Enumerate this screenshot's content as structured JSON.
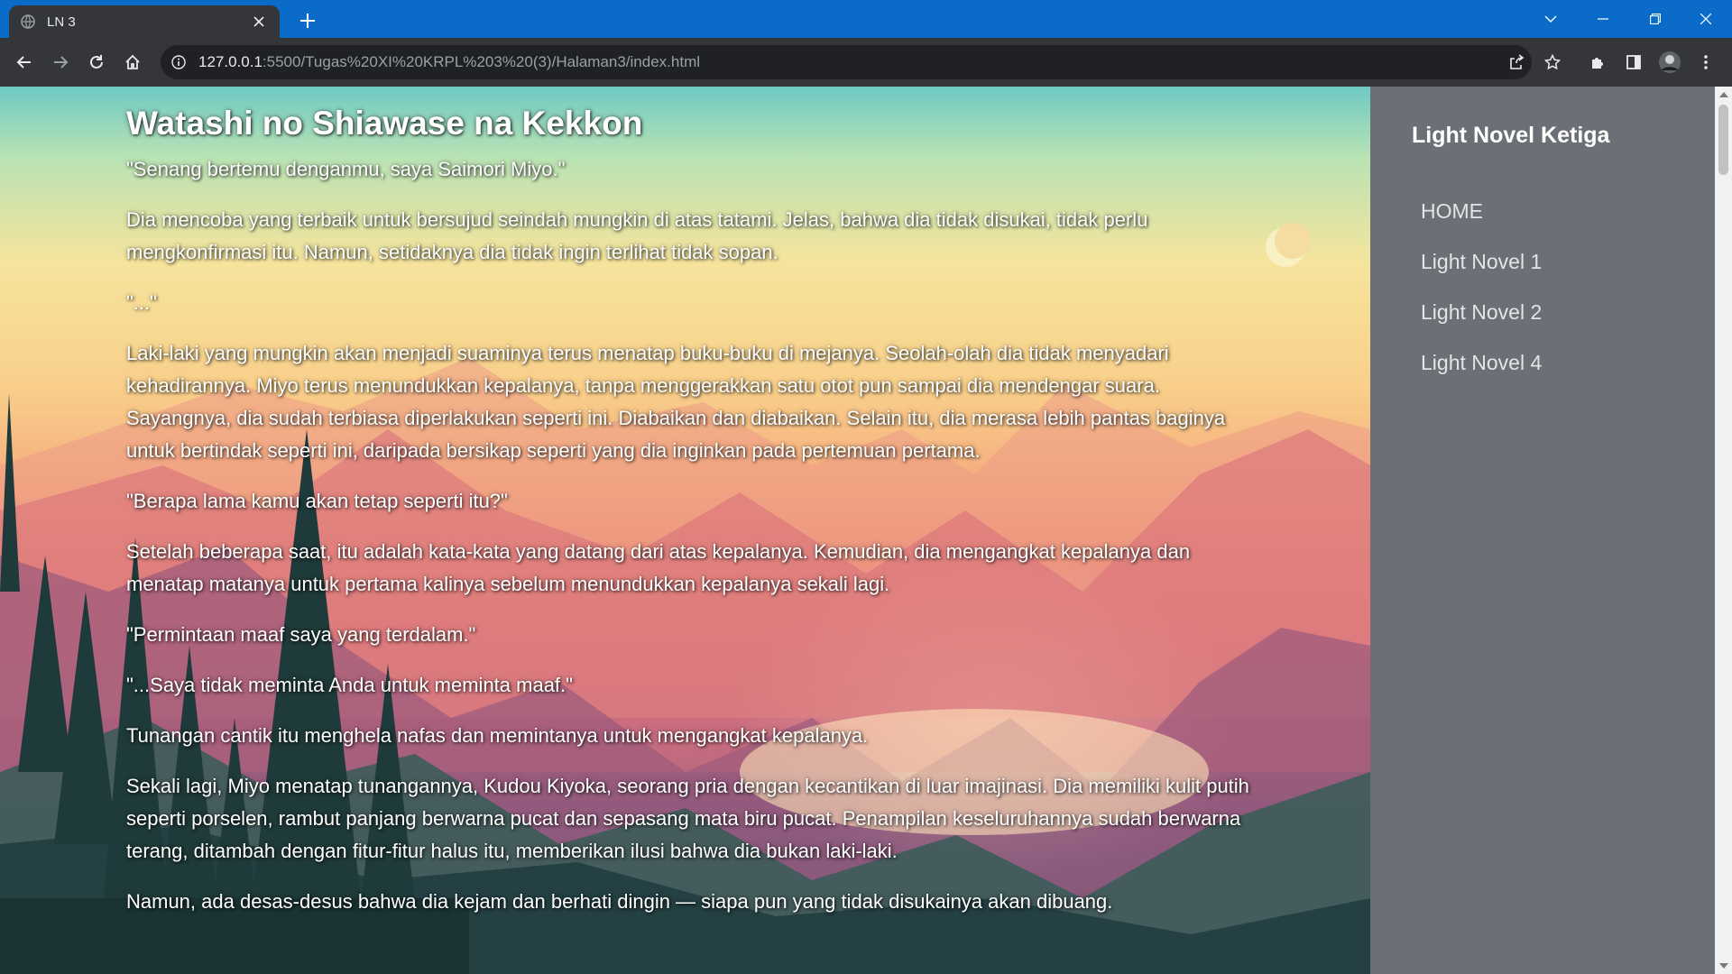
{
  "browser": {
    "tab": {
      "title": "LN 3",
      "favicon": "globe-icon",
      "close_icon": "close-icon"
    },
    "new_tab_icon": "plus-icon",
    "window_controls": [
      "chevron-down-icon",
      "minimize-icon",
      "restore-icon",
      "close-icon"
    ],
    "nav": [
      "back-icon",
      "forward-icon",
      "reload-icon",
      "home-icon"
    ],
    "address": {
      "info_icon": "info-icon",
      "host": "127.0.0.1",
      "path": ":5500/Tugas%20XI%20KRPL%203%20(3)/Halaman3/index.html"
    },
    "right_icons": [
      "share-icon",
      "star-icon",
      "extensions-icon",
      "side-panel-icon",
      "profile-avatar",
      "menu-icon"
    ]
  },
  "article": {
    "title": "Watashi no Shiawase na Kekkon",
    "paragraphs": [
      "\"Senang bertemu denganmu, saya Saimori Miyo.\"",
      "Dia mencoba yang terbaik untuk bersujud seindah mungkin di atas tatami. Jelas, bahwa dia tidak disukai, tidak perlu mengkonfirmasi itu. Namun, setidaknya dia tidak ingin terlihat tidak sopan.",
      "\"...\"",
      "Laki-laki yang mungkin akan menjadi suaminya terus menatap buku-buku di mejanya. Seolah-olah dia tidak menyadari kehadirannya. Miyo terus menundukkan kepalanya, tanpa menggerakkan satu otot pun sampai dia mendengar suara. Sayangnya, dia sudah terbiasa diperlakukan seperti ini. Diabaikan dan diabaikan. Selain itu, dia merasa lebih pantas baginya untuk bertindak seperti ini, daripada bersikap seperti yang dia inginkan pada pertemuan pertama.",
      "\"Berapa lama kamu akan tetap seperti itu?\"",
      "Setelah beberapa saat, itu adalah kata-kata yang datang dari atas kepalanya. Kemudian, dia mengangkat kepalanya dan menatap matanya untuk pertama kalinya sebelum menundukkan kepalanya sekali lagi.",
      "\"Permintaan maaf saya yang terdalam.\"",
      "\"...Saya tidak meminta Anda untuk meminta maaf.\"",
      "Tunangan cantik itu menghela nafas dan memintanya untuk mengangkat kepalanya.",
      "Sekali lagi, Miyo menatap tunangannya, Kudou Kiyoka, seorang pria dengan kecantikan di luar imajinasi. Dia memiliki kulit putih seperti porselen, rambut panjang berwarna pucat dan sepasang mata biru pucat. Penampilan keseluruhannya sudah berwarna terang, ditambah dengan fitur-fitur halus itu, memberikan ilusi bahwa dia bukan laki-laki.",
      "Namun, ada desas-desus bahwa dia kejam dan berhati dingin — siapa pun yang tidak disukainya akan dibuang."
    ]
  },
  "sidebar": {
    "title": "Light Novel Ketiga",
    "items": [
      "HOME",
      "Light Novel 1",
      "Light Novel 2",
      "Light Novel 4"
    ]
  },
  "colors": {
    "tabbar": "#0b6bc9",
    "toolbar": "#35363a",
    "sidebar": "#6b6f76"
  }
}
